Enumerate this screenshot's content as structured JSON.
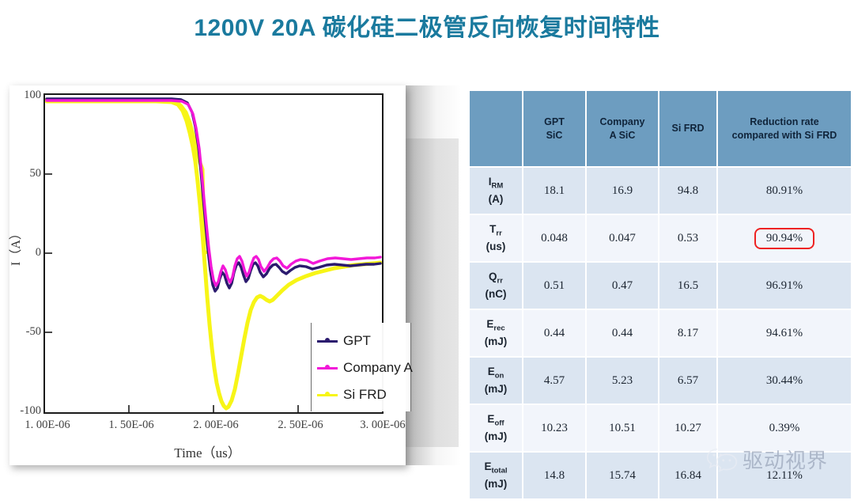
{
  "slide": {
    "title": "1200V 20A 碳化硅二极管反向恢复时间特性",
    "title_color": "#1a7a9e"
  },
  "watermark": {
    "icon": "wechat-icon",
    "text": "驱动视界"
  },
  "chart_data": {
    "type": "line",
    "title": "",
    "xlabel": "Time（us）",
    "ylabel": "I（A）",
    "xlim": [
      1e-06,
      3e-06
    ],
    "ylim": [
      -100,
      100
    ],
    "grid": false,
    "legend_position": "lower-right-inside",
    "xticks": [
      "1. 00E-06",
      "1. 50E-06",
      "2. 00E-06",
      "2. 50E-06",
      "3. 00E-06"
    ],
    "xtick_values": [
      1e-06,
      1.5e-06,
      2e-06,
      2.5e-06,
      3e-06
    ],
    "yticks": [
      "100",
      "50",
      "0",
      "-50",
      "-100"
    ],
    "ytick_values": [
      100,
      50,
      0,
      -50,
      -100
    ],
    "series": [
      {
        "name": "GPT",
        "color": "#2b1a6e",
        "x": [
          1e-06,
          1.4e-06,
          1.8e-06,
          1.86e-06,
          1.9e-06,
          1.925e-06,
          1.94e-06,
          1.955e-06,
          1.965e-06,
          1.975e-06,
          1.985e-06,
          1.995e-06,
          2.005e-06,
          2.015e-06,
          2.03e-06,
          2.05e-06,
          2.07e-06,
          2.09e-06,
          2.11e-06,
          2.14e-06,
          2.18e-06,
          2.25e-06,
          2.4e-06,
          2.6e-06,
          2.8e-06,
          3e-06
        ],
        "y": [
          97,
          97,
          97,
          93,
          60,
          25,
          -5,
          -18.1,
          -12,
          -2,
          -12,
          -4,
          -11,
          -3,
          -9,
          -4.5,
          -8,
          -4.5,
          -7,
          -5.5,
          -6.5,
          -5.5,
          -5,
          -4.5,
          -4.5,
          -4
        ]
      },
      {
        "name": "Company A",
        "color": "#f218d8",
        "x": [
          1e-06,
          1.4e-06,
          1.8e-06,
          1.86e-06,
          1.9e-06,
          1.925e-06,
          1.94e-06,
          1.955e-06,
          1.965e-06,
          1.975e-06,
          1.985e-06,
          1.995e-06,
          2.005e-06,
          2.015e-06,
          2.03e-06,
          2.05e-06,
          2.07e-06,
          2.09e-06,
          2.11e-06,
          2.14e-06,
          2.18e-06,
          2.25e-06,
          2.4e-06,
          2.6e-06,
          2.8e-06,
          3e-06
        ],
        "y": [
          97,
          97,
          97,
          94,
          64,
          30,
          0,
          -16.9,
          -10,
          1,
          -10,
          -2,
          -9,
          -1.5,
          -7.5,
          -3,
          -6.5,
          -3.5,
          -6,
          -4.5,
          -5.5,
          -4.5,
          -4,
          -3.5,
          -3.5,
          -3
        ]
      },
      {
        "name": "Si FRD",
        "color": "#f7f517",
        "x": [
          1e-06,
          1.4e-06,
          1.7e-06,
          1.8e-06,
          1.84e-06,
          1.87e-06,
          1.9e-06,
          1.93e-06,
          1.955e-06,
          1.975e-06,
          1.99e-06,
          2.005e-06,
          2.02e-06,
          2.04e-06,
          2.06e-06,
          2.09e-06,
          2.13e-06,
          2.2e-06,
          2.3e-06,
          2.45e-06,
          2.6e-06,
          2.8e-06,
          3e-06
        ],
        "y": [
          95,
          95,
          95,
          92,
          70,
          40,
          5,
          -40,
          -80,
          -94.8,
          -88,
          -66,
          -42,
          -28,
          -31,
          -27,
          -22,
          -17,
          -13,
          -10,
          -8,
          -6,
          -5
        ]
      }
    ]
  },
  "table": {
    "headers": [
      "",
      "GPT\nSiC",
      "Company\nA SiC",
      "Si FRD",
      "Reduction rate compared with Si FRD"
    ],
    "header_cells": {
      "blank": "",
      "gpt_line1": "GPT",
      "gpt_line2": "SiC",
      "company_line1": "Company",
      "company_line2": "A SiC",
      "sifrd": "Si FRD",
      "reduction": "Reduction rate compared with Si FRD"
    },
    "rows": [
      {
        "symbol": "I",
        "subscript": "RM",
        "unit": "(A)",
        "gpt": "18.1",
        "company_a": "16.9",
        "si_frd": "94.8",
        "reduction": "80.91%",
        "highlight": false
      },
      {
        "symbol": "T",
        "subscript": "rr",
        "unit": "(us)",
        "gpt": "0.048",
        "company_a": "0.047",
        "si_frd": "0.53",
        "reduction": "90.94%",
        "highlight": true
      },
      {
        "symbol": "Q",
        "subscript": "rr",
        "unit": "(nC)",
        "gpt": "0.51",
        "company_a": "0.47",
        "si_frd": "16.5",
        "reduction": "96.91%",
        "highlight": false
      },
      {
        "symbol": "E",
        "subscript": "rec",
        "unit": "(mJ)",
        "gpt": "0.44",
        "company_a": "0.44",
        "si_frd": "8.17",
        "reduction": "94.61%",
        "highlight": false
      },
      {
        "symbol": "E",
        "subscript": "on",
        "unit": "(mJ)",
        "gpt": "4.57",
        "company_a": "5.23",
        "si_frd": "6.57",
        "reduction": "30.44%",
        "highlight": false
      },
      {
        "symbol": "E",
        "subscript": "off",
        "unit": "(mJ)",
        "gpt": "10.23",
        "company_a": "10.51",
        "si_frd": "10.27",
        "reduction": "0.39%",
        "highlight": false
      },
      {
        "symbol": "E",
        "subscript": "total",
        "unit": "(mJ)",
        "gpt": "14.8",
        "company_a": "15.74",
        "si_frd": "16.84",
        "reduction": "12.11%",
        "highlight": false
      }
    ],
    "highlight_color": "#ee2222",
    "header_bg": "#6d9dc0"
  }
}
